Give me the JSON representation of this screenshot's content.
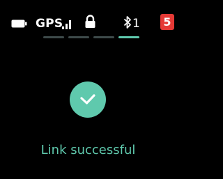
{
  "status_bar": {
    "battery_icon": "battery-icon",
    "gps_label": "GPS",
    "signal_icon": "signal-bars-icon",
    "lock_icon": "lock-icon",
    "bluetooth_icon": "bluetooth-icon",
    "bluetooth_count": "1",
    "notification_count": "5"
  },
  "pager": {
    "pages": 4,
    "active_page": 4
  },
  "main": {
    "status_icon": "checkmark-icon",
    "message": "Link successful"
  },
  "colors": {
    "background": "#000000",
    "accent": "#5fc9ad",
    "badge": "#e53935",
    "inactive_dot": "#3e4a4a"
  }
}
